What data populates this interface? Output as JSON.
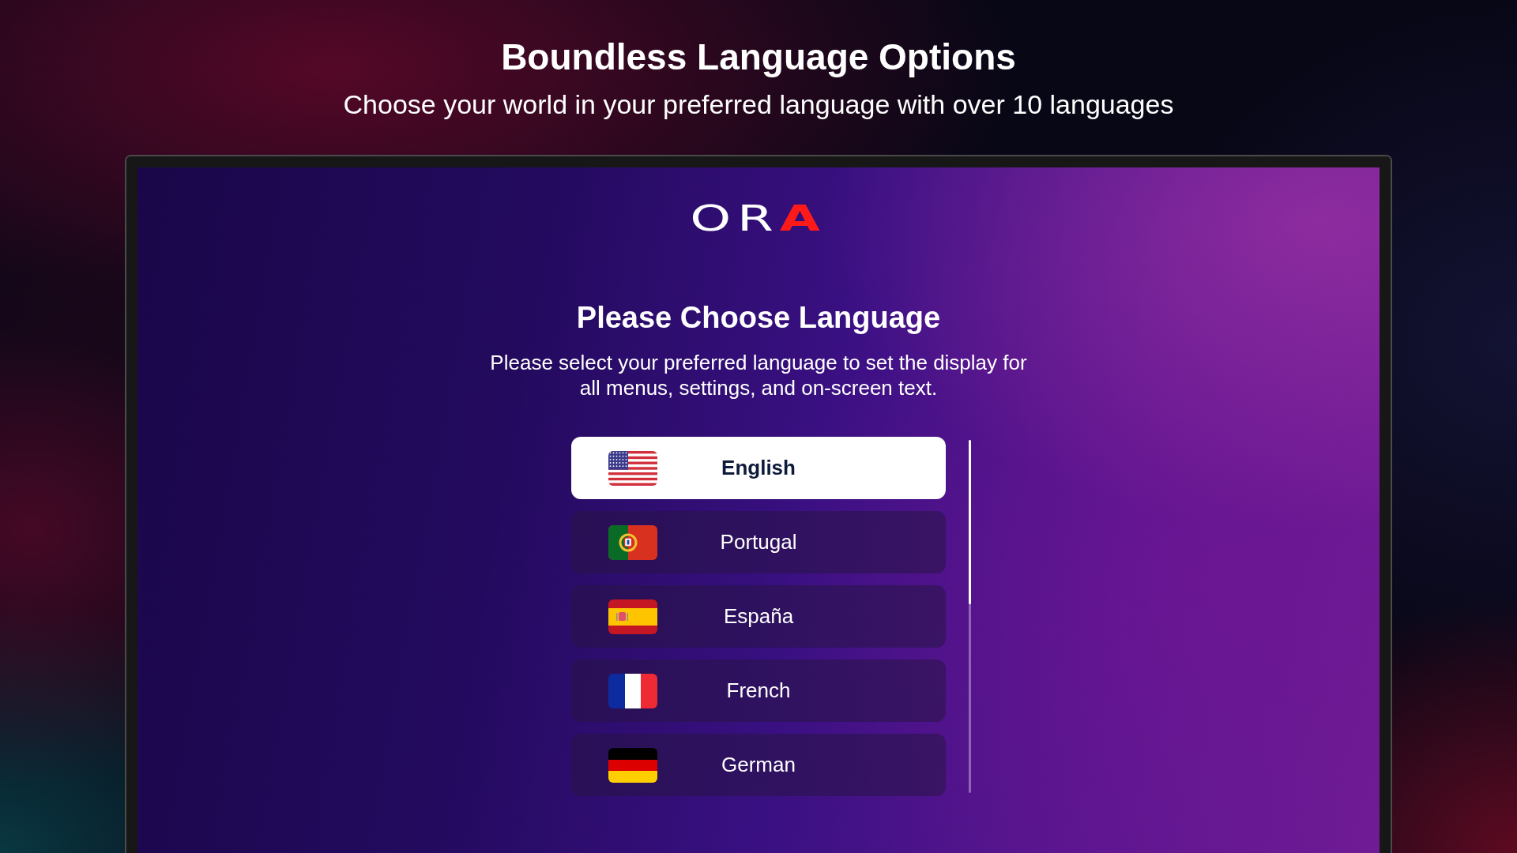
{
  "header": {
    "title": "Boundless Language Options",
    "subtitle": "Choose your world in your preferred language with over 10 languages"
  },
  "tv_screen": {
    "logo": "ORA",
    "title": "Please Choose Language",
    "description": "Please select your preferred language to set the display for all menus, settings, and on-screen text.",
    "languages": [
      {
        "label": "English",
        "kind": "usa",
        "selected": true
      },
      {
        "label": "Portugal",
        "kind": "portugal",
        "selected": false
      },
      {
        "label": "España",
        "kind": "spain",
        "selected": false
      },
      {
        "label": "French",
        "kind": "france",
        "selected": false
      },
      {
        "label": "German",
        "kind": "germany",
        "selected": false
      }
    ]
  }
}
